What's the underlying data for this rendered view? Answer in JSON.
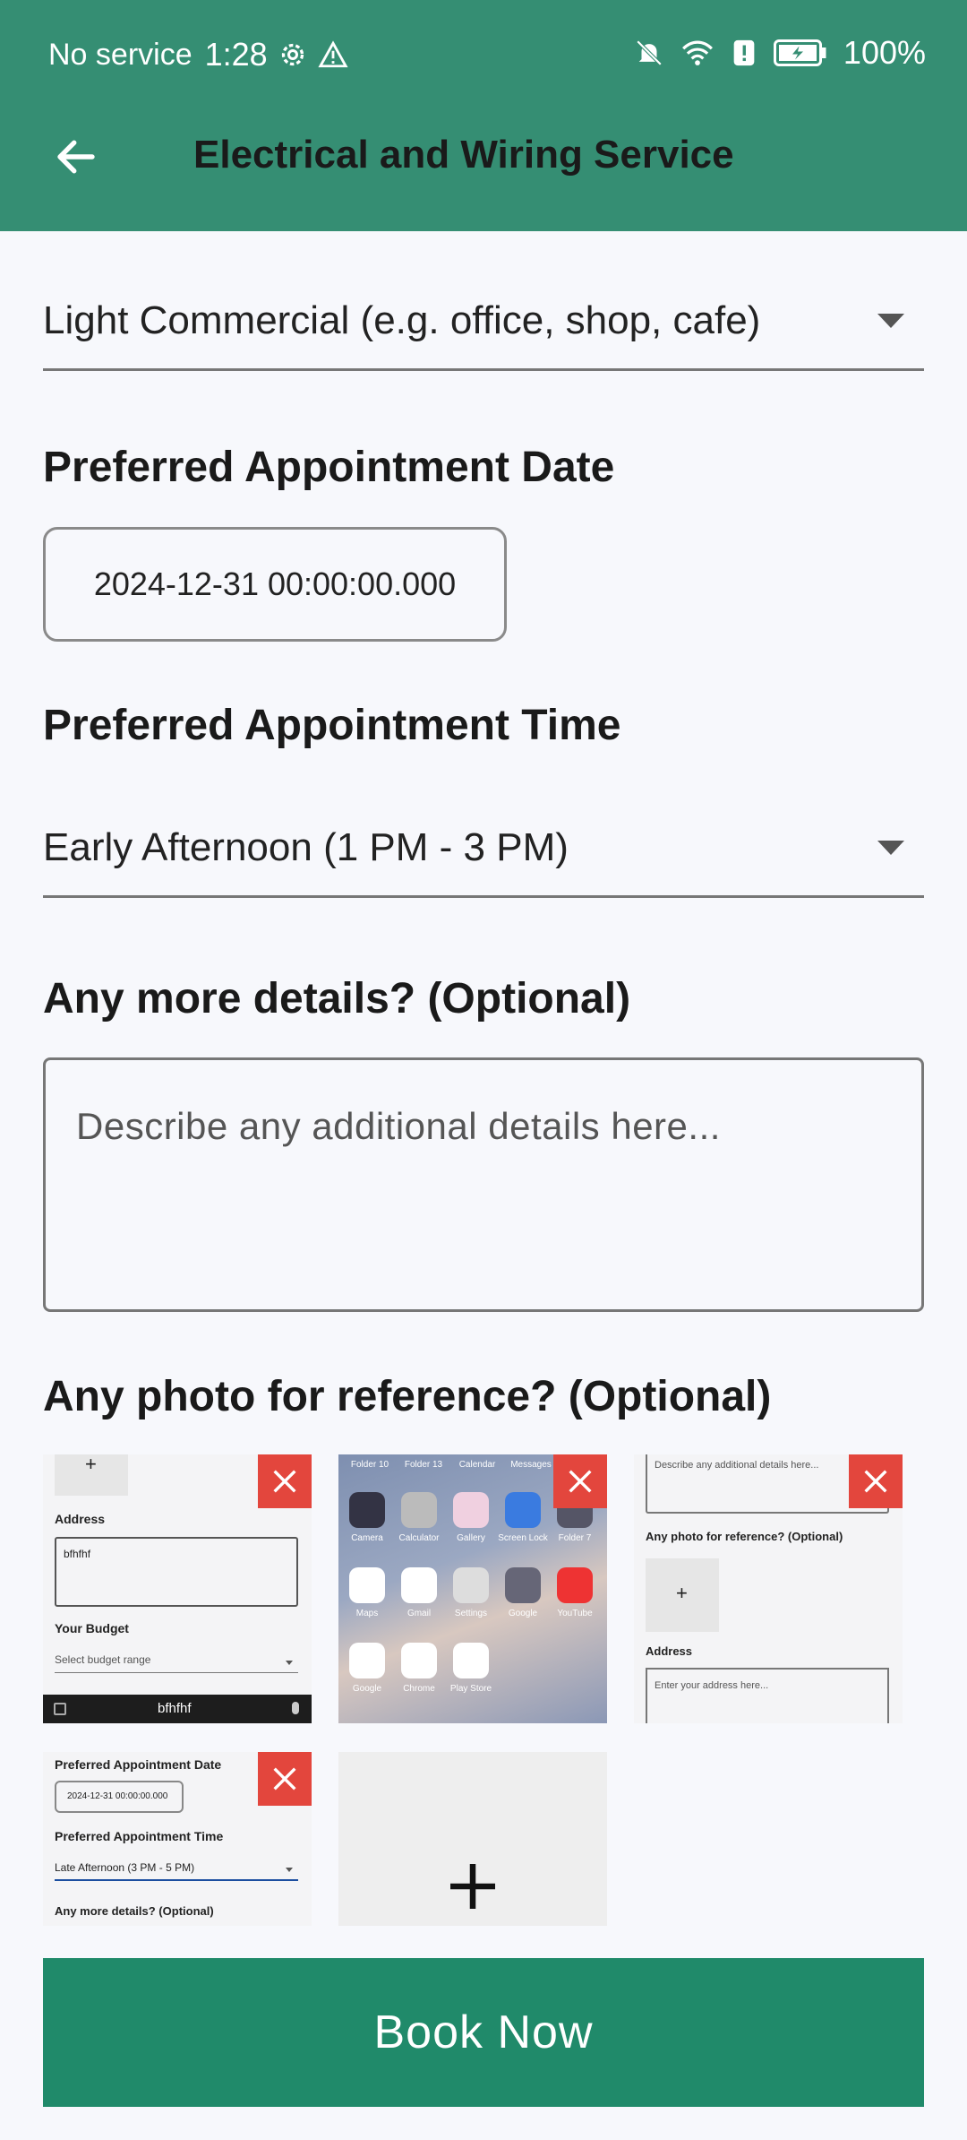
{
  "status": {
    "carrier": "No service",
    "time": "1:28",
    "battery": "100%"
  },
  "appbar": {
    "title": "Electrical and Wiring Service"
  },
  "form": {
    "property_type": "Light Commercial (e.g. office, shop, cafe)",
    "date_label": "Preferred Appointment Date",
    "date_value": "2024-12-31 00:00:00.000",
    "time_label": "Preferred Appointment Time",
    "time_value": "Early Afternoon (1 PM - 3 PM)",
    "details_label": "Any more details? (Optional)",
    "details_placeholder": "Describe any additional details here...",
    "photo_label": "Any photo for reference? (Optional)"
  },
  "thumbs": {
    "t1": {
      "plus": "+",
      "address_label": "Address",
      "address_value": "bfhfhf",
      "budget_label": "Your Budget",
      "budget_placeholder": "Select budget range",
      "keyboard_text": "bfhfhf"
    },
    "t2": {
      "folders": [
        "Folder 10",
        "Folder 13",
        "Calendar",
        "Messages"
      ],
      "row1": [
        "Camera",
        "Calculator",
        "Gallery",
        "Screen Lock",
        "Folder 7"
      ],
      "row2": [
        "Maps",
        "Gmail",
        "Settings",
        "Google",
        "YouTube"
      ],
      "row3": [
        "Google",
        "Chrome",
        "Play Store"
      ]
    },
    "t3": {
      "details_placeholder": "Describe any additional details here...",
      "photo_label": "Any photo for reference? (Optional)",
      "plus": "+",
      "address_label": "Address",
      "address_placeholder": "Enter your address here..."
    },
    "t4": {
      "date_label": "Preferred Appointment Date",
      "date_value": "2024-12-31 00:00:00.000",
      "time_label": "Preferred Appointment Time",
      "time_value": "Late Afternoon (3 PM - 5 PM)",
      "details_label": "Any more details? (Optional)"
    }
  },
  "add_photo_glyph": "+",
  "book_button": "Book Now",
  "colors": {
    "primary": "#358e73",
    "button": "#208a6a",
    "delete": "#e3463d"
  }
}
